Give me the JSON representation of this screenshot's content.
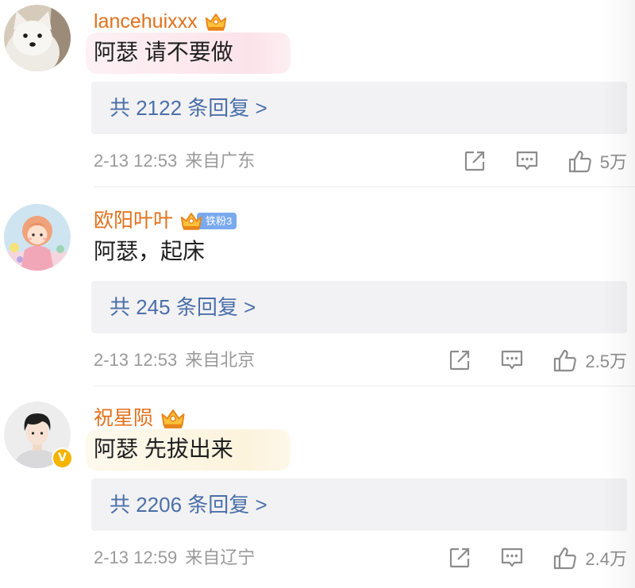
{
  "colors": {
    "username": "#e2701b",
    "comment_text": "#1f1f1f",
    "reply_link": "#4b6fa9",
    "reply_box_bg": "#f2f2f4",
    "meta_text": "#9a9a9a",
    "icon": "#8c8c8c",
    "divider": "#ececec",
    "fan_badge": "#7aa9ee",
    "verified_badge": "#f5b400"
  },
  "icons": {
    "share": "share-icon",
    "comment": "comment-icon",
    "like": "thumbs-up-icon",
    "vip": "vip-crown-icon"
  },
  "comments": [
    {
      "avatar_icon": "samoyed-dog-avatar",
      "username": "lancehuixxx",
      "text": "阿瑟 请不要做",
      "bubble_color": "#fbe3ea",
      "replies_label": "共 2122 条回复 >",
      "time": "2-13 12:53",
      "location": "来自广东",
      "likes": "5万"
    },
    {
      "avatar_icon": "cartoon-girl-avatar",
      "username": "欧阳叶叶",
      "fan_badge": "铁粉3",
      "text": "阿瑟，起床",
      "replies_label": "共 245 条回复 >",
      "time": "2-13 12:53",
      "location": "来自北京",
      "likes": "2.5万"
    },
    {
      "avatar_icon": "young-man-avatar",
      "verified_badge": "V",
      "username": "祝星陨",
      "text": "阿瑟 先拔出来",
      "bubble_color": "#fcf3dc",
      "replies_label": "共 2206 条回复 >",
      "time": "2-13 12:59",
      "location": "来自辽宁",
      "likes": "2.4万"
    }
  ]
}
